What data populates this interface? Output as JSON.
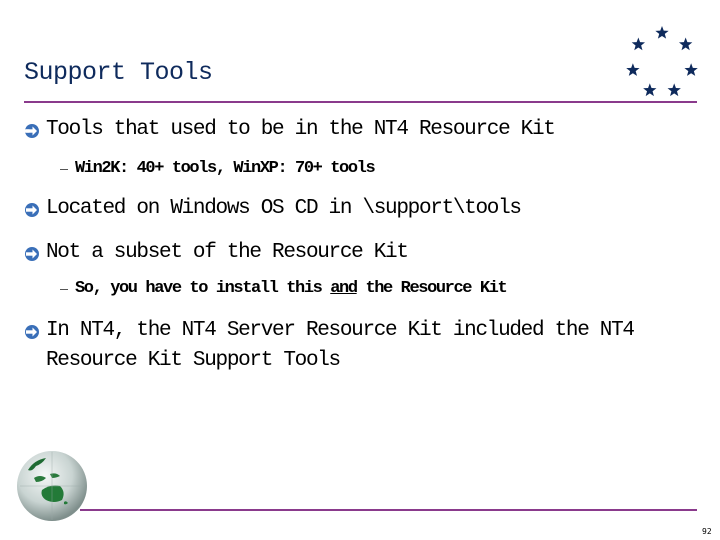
{
  "slide": {
    "title": "Support Tools",
    "page_number": "92",
    "colors": {
      "title": "#0e2a5c",
      "rule": "#8a3a8c",
      "bullet_arrow": "#3a6fb8",
      "stars": "#0e2a5c"
    },
    "decorations": {
      "top_right": "star-circle-icon",
      "bottom_left": "globe-icon",
      "bullet": "circled-arrow-icon"
    },
    "bullets": [
      {
        "text": "Tools that used to be in the NT4 Resource Kit",
        "sub": [
          {
            "text": "Win2K: 40+ tools, WinXP: 70+ tools"
          }
        ]
      },
      {
        "text": "Located on Windows OS CD in \\support\\tools",
        "sub": []
      },
      {
        "text": "Not a subset of the Resource Kit",
        "sub": [
          {
            "pre": "So, you have to install this ",
            "emph": "and",
            "post": " the Resource Kit"
          }
        ]
      },
      {
        "line1": "In NT4, the NT4 Server Resource Kit included the NT4",
        "line2": "Resource Kit Support Tools",
        "sub": []
      }
    ]
  }
}
